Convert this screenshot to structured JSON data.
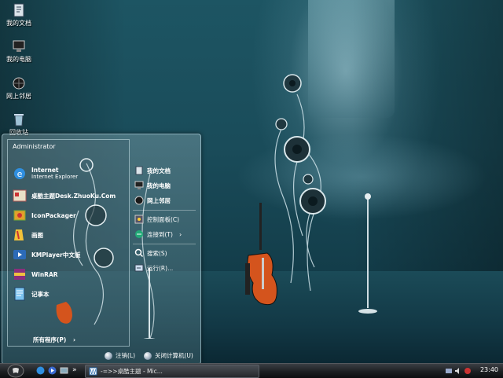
{
  "desktop": {
    "icons": [
      {
        "label": "我的文档",
        "icon": "my-documents-icon"
      },
      {
        "label": "我的电脑",
        "icon": "my-computer-icon"
      },
      {
        "label": "网上邻居",
        "icon": "network-places-icon"
      },
      {
        "label": "回收站",
        "icon": "recycle-bin-icon"
      }
    ]
  },
  "start_menu": {
    "user": "Administrator",
    "programs": [
      {
        "label": "Internet",
        "sub": "Internet Explorer",
        "icon": "internet-explorer-icon"
      },
      {
        "label": "桌酷主题Desk.ZhuoKu.Com",
        "sub": "",
        "icon": "desktop-theme-icon"
      },
      {
        "label": "IconPackager",
        "sub": "",
        "icon": "iconpackager-icon"
      },
      {
        "label": "画图",
        "sub": "",
        "icon": "paint-icon"
      },
      {
        "label": "KMPlayer中文版",
        "sub": "",
        "icon": "kmplayer-icon"
      },
      {
        "label": "WinRAR",
        "sub": "",
        "icon": "winrar-icon"
      },
      {
        "label": "记事本",
        "sub": "",
        "icon": "notepad-icon"
      }
    ],
    "all_programs": "所有程序(P)",
    "places": [
      {
        "label": "我的文档",
        "icon": "my-documents-icon"
      },
      {
        "label": "我的电脑",
        "icon": "my-computer-icon"
      },
      {
        "label": "网上邻居",
        "icon": "network-places-icon"
      }
    ],
    "settings": [
      {
        "label": "控制面板(C)",
        "icon": "control-panel-icon"
      },
      {
        "label": "连接到(T)",
        "icon": "connect-to-icon"
      }
    ],
    "tools": [
      {
        "label": "搜索(S)",
        "icon": "search-icon"
      },
      {
        "label": "运行(R)...",
        "icon": "run-icon"
      }
    ],
    "logoff": "注销(L)",
    "shutdown": "关闭计算机(U)"
  },
  "taskbar": {
    "task_button": "-=>>桌酷主题 - Mic...",
    "clock": "23:40"
  },
  "colors": {
    "accent": "#1d5563",
    "taskbar": "#1c1f22"
  }
}
